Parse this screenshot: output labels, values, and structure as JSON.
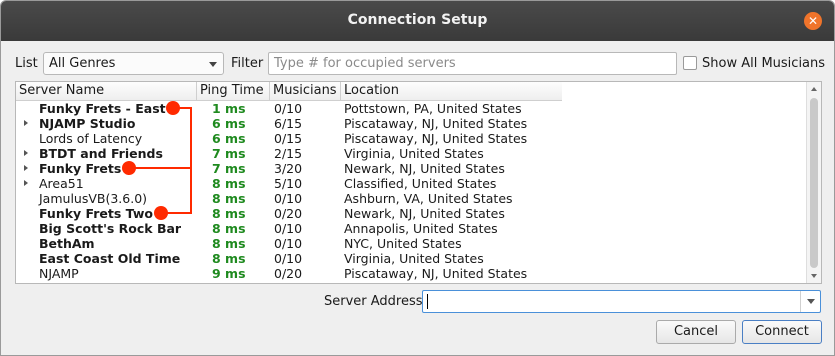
{
  "window": {
    "title": "Connection Setup"
  },
  "filters": {
    "list_label": "List",
    "list_value": "All Genres",
    "filter_label": "Filter",
    "filter_placeholder": "Type # for occupied servers",
    "show_all_label": "Show All Musicians"
  },
  "table": {
    "columns": [
      "Server Name",
      "Ping Time",
      "Musicians",
      "Location"
    ],
    "rows": [
      {
        "name": "Funky Frets - East",
        "ping": "1 ms",
        "musicians": "0/10",
        "location": "Pottstown, PA, United States",
        "bold": true,
        "expandable": false
      },
      {
        "name": "NJAMP Studio",
        "ping": "6 ms",
        "musicians": "6/15",
        "location": "Piscataway, NJ, United States",
        "bold": true,
        "expandable": true
      },
      {
        "name": "Lords of Latency",
        "ping": "6 ms",
        "musicians": "0/15",
        "location": "Piscataway, NJ, United States",
        "bold": false,
        "expandable": false
      },
      {
        "name": "BTDT and Friends",
        "ping": "7 ms",
        "musicians": "2/15",
        "location": "Virginia, United States",
        "bold": true,
        "expandable": true
      },
      {
        "name": "Funky Frets",
        "ping": "7 ms",
        "musicians": "3/20",
        "location": "Newark, NJ, United States",
        "bold": true,
        "expandable": true
      },
      {
        "name": "Area51",
        "ping": "8 ms",
        "musicians": "5/10",
        "location": "Classified, United States",
        "bold": false,
        "expandable": true
      },
      {
        "name": "JamulusVB(3.6.0)",
        "ping": "8 ms",
        "musicians": "0/10",
        "location": "Ashburn, VA, United States",
        "bold": false,
        "expandable": false
      },
      {
        "name": "Funky Frets Two",
        "ping": "8 ms",
        "musicians": "0/20",
        "location": "Newark, NJ, United States",
        "bold": true,
        "expandable": false
      },
      {
        "name": "Big Scott's Rock Bar",
        "ping": "8 ms",
        "musicians": "0/10",
        "location": "Annapolis, United States",
        "bold": true,
        "expandable": false
      },
      {
        "name": "BethAm",
        "ping": "8 ms",
        "musicians": "0/10",
        "location": "NYC, United States",
        "bold": true,
        "expandable": false
      },
      {
        "name": "East Coast Old Time",
        "ping": "8 ms",
        "musicians": "0/10",
        "location": "Virginia, United States",
        "bold": true,
        "expandable": false
      },
      {
        "name": "NJAMP",
        "ping": "9 ms",
        "musicians": "0/20",
        "location": "Piscataway, NJ, United States",
        "bold": false,
        "expandable": false
      }
    ]
  },
  "address": {
    "label": "Server Address",
    "value": ""
  },
  "buttons": {
    "cancel": "Cancel",
    "connect": "Connect"
  },
  "colors": {
    "ping_green": "#1f8a1f",
    "annotation_red": "#ff2a00",
    "titlebar": "#3f3f3f",
    "close": "#f0742b"
  }
}
